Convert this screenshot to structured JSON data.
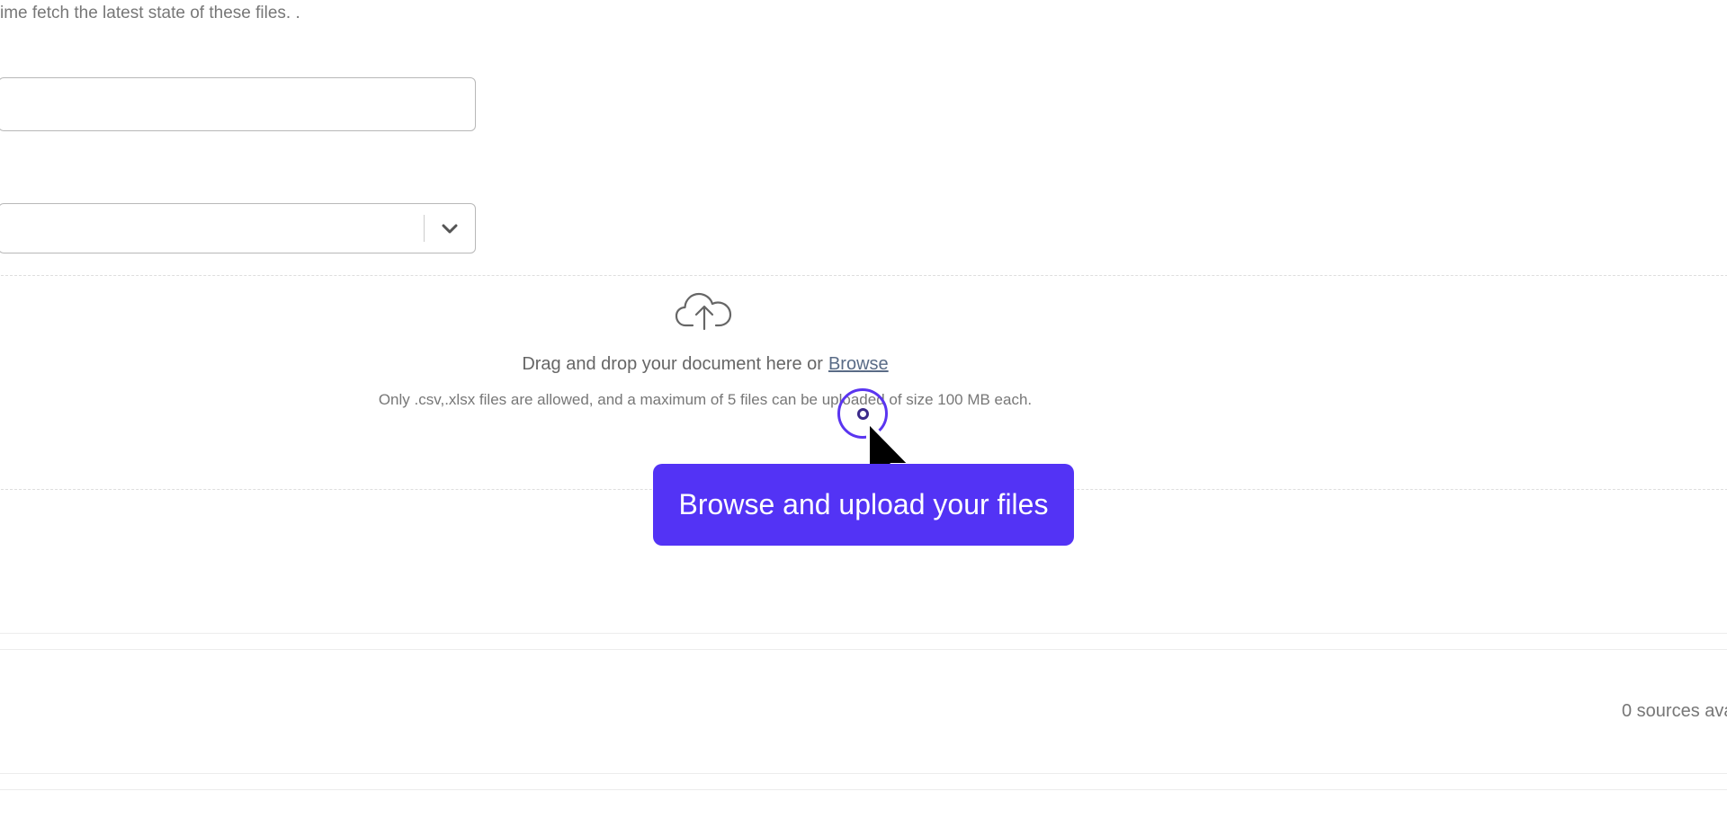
{
  "form": {
    "help_text": "ime fetch the latest state of these files. .",
    "name_input": {
      "value": "",
      "placeholder": ""
    },
    "select": {
      "value": ""
    }
  },
  "upload": {
    "drop_text": "Drag and drop your document here or",
    "browse_label": "Browse",
    "rules_text": "Only .csv,.xlsx files are allowed, and a maximum of 5 files can be uploaded of size 100 MB each.",
    "icon": "cloud-upload-icon"
  },
  "tooltip": {
    "text": "Browse and upload your files"
  },
  "sources": {
    "count_text": "0 sources ava"
  },
  "colors": {
    "accent": "#5333f5",
    "link": "#596b86",
    "ring": "#5a35f0"
  }
}
